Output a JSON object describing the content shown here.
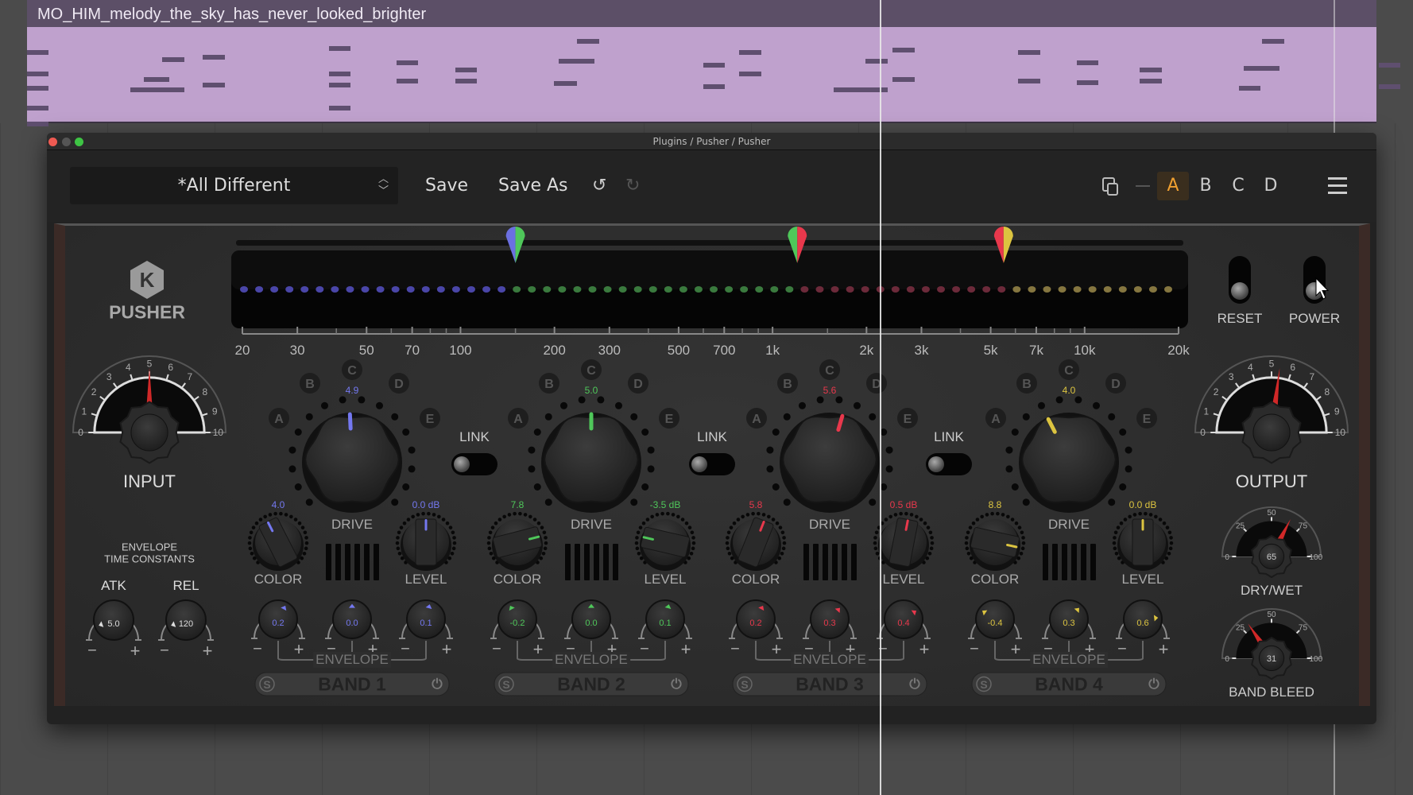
{
  "track": {
    "clip_name": "MO_HIM_melody_the_sky_has_never_looked_brighter",
    "clip_color": "#bfa1cd"
  },
  "window": {
    "title": "Plugins / Pusher / Pusher"
  },
  "toolbar": {
    "preset": "*All Different",
    "save": "Save",
    "save_as": "Save As",
    "undo_icon": "undo-icon",
    "redo_icon": "redo-icon",
    "copy_icon": "copy-icon",
    "menu_icon": "hamburger-menu-icon",
    "slots": [
      {
        "label": "A",
        "active": true
      },
      {
        "label": "B",
        "active": false
      },
      {
        "label": "C",
        "active": false
      },
      {
        "label": "D",
        "active": false
      }
    ],
    "accent": "#f0a030"
  },
  "plugin": {
    "logo": "PUSHER",
    "freq_labels": [
      "20",
      "30",
      "50",
      "70",
      "100",
      "200",
      "300",
      "500",
      "700",
      "1k",
      "2k",
      "3k",
      "5k",
      "7k",
      "10k",
      "20k"
    ],
    "crossovers_hz": [
      150,
      1200,
      5500
    ],
    "input": {
      "label": "INPUT",
      "value": 5.0,
      "scale": [
        "0",
        "1",
        "2",
        "3",
        "4",
        "5",
        "6",
        "7",
        "8",
        "9",
        "10"
      ]
    },
    "output": {
      "label": "OUTPUT",
      "value": 5.4,
      "scale": [
        "0",
        "1",
        "2",
        "3",
        "4",
        "5",
        "6",
        "7",
        "8",
        "9",
        "10"
      ]
    },
    "reset": "RESET",
    "power": "POWER",
    "dry_wet": {
      "label": "DRY/WET",
      "value": "65",
      "scale": [
        "0",
        "25",
        "50",
        "75",
        "100"
      ]
    },
    "band_bleed": {
      "label": "BAND BLEED",
      "value": "31",
      "scale": [
        "0",
        "25",
        "50",
        "75",
        "100"
      ]
    },
    "envelope_tc": {
      "title1": "ENVELOPE",
      "title2": "TIME CONSTANTS",
      "atk_label": "ATK",
      "atk": "5.0",
      "rel_label": "REL",
      "rel": "120"
    },
    "link_label": "LINK",
    "links": [
      false,
      false,
      false
    ],
    "mode_letters": [
      "A",
      "B",
      "C",
      "D",
      "E"
    ],
    "drive_label": "DRIVE",
    "color_label": "COLOR",
    "level_label": "LEVEL",
    "envelope_label": "ENVELOPE",
    "solo": "S",
    "bands": [
      {
        "name": "BAND 1",
        "color": "#7478f0",
        "drive": "4.9",
        "color_val": "4.0",
        "level": "0.0 dB",
        "env": [
          "0.2",
          "0.0",
          "0.1"
        ]
      },
      {
        "name": "BAND 2",
        "color": "#4fc75a",
        "drive": "5.0",
        "color_val": "7.8",
        "level": "-3.5 dB",
        "env": [
          "-0.2",
          "0.0",
          "0.1"
        ]
      },
      {
        "name": "BAND 3",
        "color": "#e8384c",
        "drive": "5.6",
        "color_val": "5.8",
        "level": "0.5 dB",
        "env": [
          "0.2",
          "0.3",
          "0.4"
        ]
      },
      {
        "name": "BAND 4",
        "color": "#dcc440",
        "drive": "4.0",
        "color_val": "8.8",
        "level": "0.0 dB",
        "env": [
          "-0.4",
          "0.3",
          "0.6"
        ]
      }
    ]
  }
}
